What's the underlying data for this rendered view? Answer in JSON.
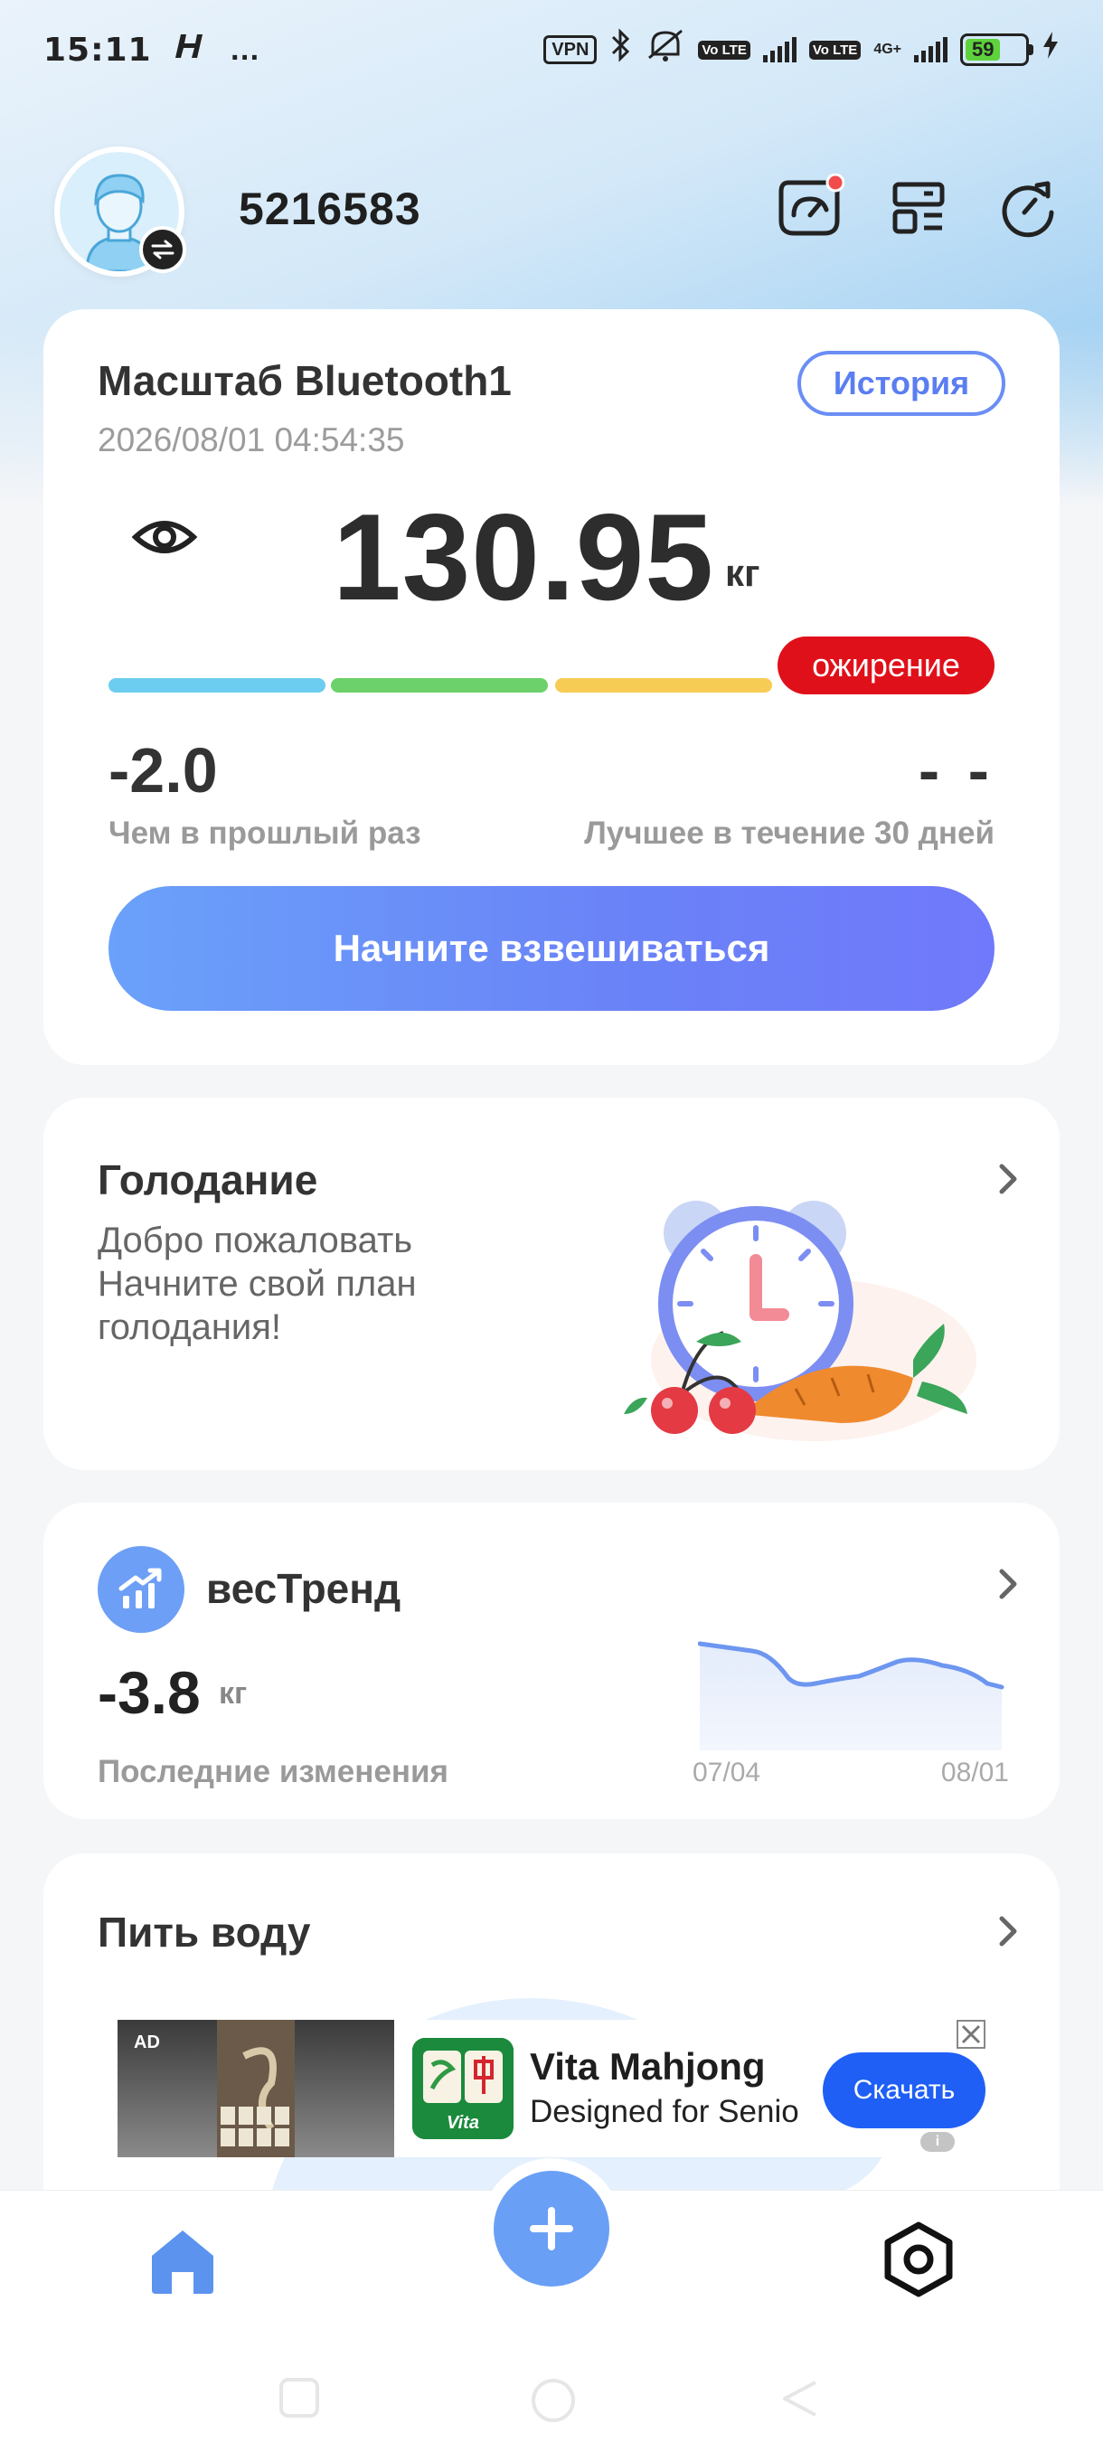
{
  "status_bar": {
    "time": "15:11",
    "extra": "…",
    "vpn": "VPN",
    "lte1": "Vo LTE",
    "lte2": "Vo LTE",
    "net": "4G+",
    "battery": "59"
  },
  "header": {
    "user_id": "5216583",
    "icons": [
      "gauge-icon",
      "dashboard-icon",
      "refresh-icon"
    ]
  },
  "scale_card": {
    "title": "Масштаб Bluetooth1",
    "datetime": "2026/08/01 04:54:35",
    "history_label": "История",
    "weight": "130.95",
    "unit": "кг",
    "bmi_status": "ожирение",
    "bmi_status_color": "#e0101a",
    "bar_colors": [
      "#6ccdf0",
      "#6cd16a",
      "#f7cc55",
      "#e0101a"
    ],
    "diff_value": "-2.0",
    "diff_label": "Чем в прошлый раз",
    "best_value": "- -",
    "best_label": "Лучшее в течение 30 дней",
    "start_button": "Начните взвешиваться"
  },
  "fasting_card": {
    "title": "Голодание",
    "description": "Добро пожаловать Начните свой план голодания!"
  },
  "trend_card": {
    "title": "весТренд",
    "value": "-3.8",
    "unit": "кг",
    "label": "Последние изменения",
    "x_start": "07/04",
    "x_end": "08/01"
  },
  "water_card": {
    "title": "Пить воду"
  },
  "ad": {
    "badge": "AD",
    "title": "Vita Mahjong",
    "subtitle": "Designed for Senio",
    "button": "Скачать",
    "app_label": "Vita",
    "info": "i"
  },
  "accent_color": "#6a8ef5"
}
